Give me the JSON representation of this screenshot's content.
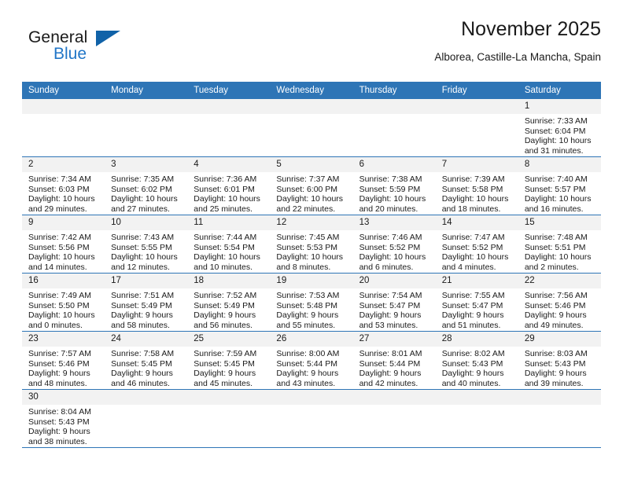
{
  "brand": {
    "name_part1": "General",
    "name_part2": "Blue",
    "accent_color": "#2176c7",
    "triangle_color": "#1062a8"
  },
  "header": {
    "title": "November 2025",
    "subtitle": "Alborea, Castille-La Mancha, Spain"
  },
  "theme": {
    "header_row_bg": "#2e75b6",
    "daynum_bg": "#f2f2f2",
    "grid_line": "#2e75b6",
    "text": "#1a1a1a"
  },
  "weekdays": [
    "Sunday",
    "Monday",
    "Tuesday",
    "Wednesday",
    "Thursday",
    "Friday",
    "Saturday"
  ],
  "weeks": [
    [
      {
        "blank": true
      },
      {
        "blank": true
      },
      {
        "blank": true
      },
      {
        "blank": true
      },
      {
        "blank": true
      },
      {
        "blank": true
      },
      {
        "day": "1",
        "sunrise": "Sunrise: 7:33 AM",
        "sunset": "Sunset: 6:04 PM",
        "daylight": "Daylight: 10 hours and 31 minutes."
      }
    ],
    [
      {
        "day": "2",
        "sunrise": "Sunrise: 7:34 AM",
        "sunset": "Sunset: 6:03 PM",
        "daylight": "Daylight: 10 hours and 29 minutes."
      },
      {
        "day": "3",
        "sunrise": "Sunrise: 7:35 AM",
        "sunset": "Sunset: 6:02 PM",
        "daylight": "Daylight: 10 hours and 27 minutes."
      },
      {
        "day": "4",
        "sunrise": "Sunrise: 7:36 AM",
        "sunset": "Sunset: 6:01 PM",
        "daylight": "Daylight: 10 hours and 25 minutes."
      },
      {
        "day": "5",
        "sunrise": "Sunrise: 7:37 AM",
        "sunset": "Sunset: 6:00 PM",
        "daylight": "Daylight: 10 hours and 22 minutes."
      },
      {
        "day": "6",
        "sunrise": "Sunrise: 7:38 AM",
        "sunset": "Sunset: 5:59 PM",
        "daylight": "Daylight: 10 hours and 20 minutes."
      },
      {
        "day": "7",
        "sunrise": "Sunrise: 7:39 AM",
        "sunset": "Sunset: 5:58 PM",
        "daylight": "Daylight: 10 hours and 18 minutes."
      },
      {
        "day": "8",
        "sunrise": "Sunrise: 7:40 AM",
        "sunset": "Sunset: 5:57 PM",
        "daylight": "Daylight: 10 hours and 16 minutes."
      }
    ],
    [
      {
        "day": "9",
        "sunrise": "Sunrise: 7:42 AM",
        "sunset": "Sunset: 5:56 PM",
        "daylight": "Daylight: 10 hours and 14 minutes."
      },
      {
        "day": "10",
        "sunrise": "Sunrise: 7:43 AM",
        "sunset": "Sunset: 5:55 PM",
        "daylight": "Daylight: 10 hours and 12 minutes."
      },
      {
        "day": "11",
        "sunrise": "Sunrise: 7:44 AM",
        "sunset": "Sunset: 5:54 PM",
        "daylight": "Daylight: 10 hours and 10 minutes."
      },
      {
        "day": "12",
        "sunrise": "Sunrise: 7:45 AM",
        "sunset": "Sunset: 5:53 PM",
        "daylight": "Daylight: 10 hours and 8 minutes."
      },
      {
        "day": "13",
        "sunrise": "Sunrise: 7:46 AM",
        "sunset": "Sunset: 5:52 PM",
        "daylight": "Daylight: 10 hours and 6 minutes."
      },
      {
        "day": "14",
        "sunrise": "Sunrise: 7:47 AM",
        "sunset": "Sunset: 5:52 PM",
        "daylight": "Daylight: 10 hours and 4 minutes."
      },
      {
        "day": "15",
        "sunrise": "Sunrise: 7:48 AM",
        "sunset": "Sunset: 5:51 PM",
        "daylight": "Daylight: 10 hours and 2 minutes."
      }
    ],
    [
      {
        "day": "16",
        "sunrise": "Sunrise: 7:49 AM",
        "sunset": "Sunset: 5:50 PM",
        "daylight": "Daylight: 10 hours and 0 minutes."
      },
      {
        "day": "17",
        "sunrise": "Sunrise: 7:51 AM",
        "sunset": "Sunset: 5:49 PM",
        "daylight": "Daylight: 9 hours and 58 minutes."
      },
      {
        "day": "18",
        "sunrise": "Sunrise: 7:52 AM",
        "sunset": "Sunset: 5:49 PM",
        "daylight": "Daylight: 9 hours and 56 minutes."
      },
      {
        "day": "19",
        "sunrise": "Sunrise: 7:53 AM",
        "sunset": "Sunset: 5:48 PM",
        "daylight": "Daylight: 9 hours and 55 minutes."
      },
      {
        "day": "20",
        "sunrise": "Sunrise: 7:54 AM",
        "sunset": "Sunset: 5:47 PM",
        "daylight": "Daylight: 9 hours and 53 minutes."
      },
      {
        "day": "21",
        "sunrise": "Sunrise: 7:55 AM",
        "sunset": "Sunset: 5:47 PM",
        "daylight": "Daylight: 9 hours and 51 minutes."
      },
      {
        "day": "22",
        "sunrise": "Sunrise: 7:56 AM",
        "sunset": "Sunset: 5:46 PM",
        "daylight": "Daylight: 9 hours and 49 minutes."
      }
    ],
    [
      {
        "day": "23",
        "sunrise": "Sunrise: 7:57 AM",
        "sunset": "Sunset: 5:46 PM",
        "daylight": "Daylight: 9 hours and 48 minutes."
      },
      {
        "day": "24",
        "sunrise": "Sunrise: 7:58 AM",
        "sunset": "Sunset: 5:45 PM",
        "daylight": "Daylight: 9 hours and 46 minutes."
      },
      {
        "day": "25",
        "sunrise": "Sunrise: 7:59 AM",
        "sunset": "Sunset: 5:45 PM",
        "daylight": "Daylight: 9 hours and 45 minutes."
      },
      {
        "day": "26",
        "sunrise": "Sunrise: 8:00 AM",
        "sunset": "Sunset: 5:44 PM",
        "daylight": "Daylight: 9 hours and 43 minutes."
      },
      {
        "day": "27",
        "sunrise": "Sunrise: 8:01 AM",
        "sunset": "Sunset: 5:44 PM",
        "daylight": "Daylight: 9 hours and 42 minutes."
      },
      {
        "day": "28",
        "sunrise": "Sunrise: 8:02 AM",
        "sunset": "Sunset: 5:43 PM",
        "daylight": "Daylight: 9 hours and 40 minutes."
      },
      {
        "day": "29",
        "sunrise": "Sunrise: 8:03 AM",
        "sunset": "Sunset: 5:43 PM",
        "daylight": "Daylight: 9 hours and 39 minutes."
      }
    ],
    [
      {
        "day": "30",
        "sunrise": "Sunrise: 8:04 AM",
        "sunset": "Sunset: 5:43 PM",
        "daylight": "Daylight: 9 hours and 38 minutes."
      },
      {
        "blank": true
      },
      {
        "blank": true
      },
      {
        "blank": true
      },
      {
        "blank": true
      },
      {
        "blank": true
      },
      {
        "blank": true
      }
    ]
  ]
}
